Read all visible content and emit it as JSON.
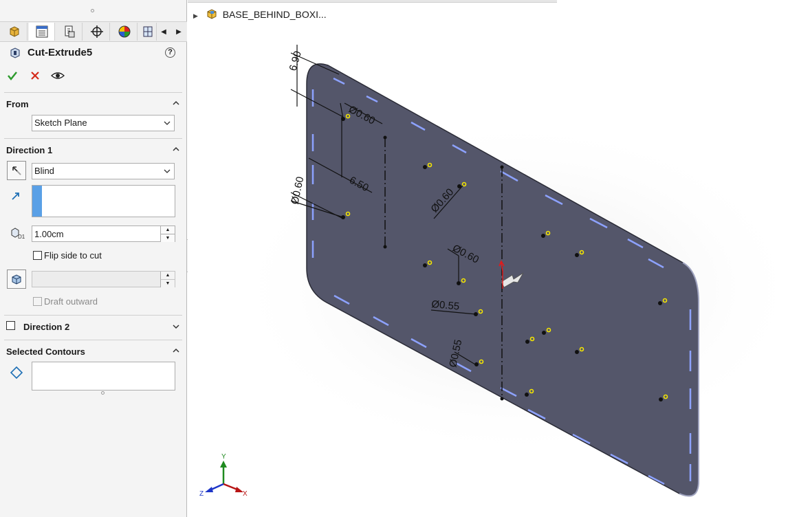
{
  "feature": {
    "title": "Cut-Extrude5",
    "help_glyph": "?"
  },
  "tabs": [
    "feature-manager-icon",
    "property-manager-icon",
    "configuration-manager-icon",
    "dimxpert-icon",
    "display-manager-icon",
    "cam-icon"
  ],
  "from": {
    "label": "From",
    "value": "Sketch Plane"
  },
  "direction1": {
    "label": "Direction 1",
    "end_condition": "Blind",
    "depth": "1.00cm",
    "flip_side_label": "Flip side to cut",
    "draft_outward_label": "Draft outward"
  },
  "direction2": {
    "label": "Direction 2"
  },
  "selected_contours": {
    "label": "Selected Contours"
  },
  "tree": {
    "part_name": "BASE_BEHIND_BOXI..."
  },
  "dimensions": {
    "d1": "6.90",
    "d2": "Ø0.60",
    "d3": "6.50",
    "d4": "Ø0.60",
    "d5": "Ø0.60",
    "d6": "Ø0.60",
    "d7": "Ø0.55",
    "d8": "Ø0.55"
  },
  "triad": {
    "x": "X",
    "y": "Y",
    "z": "Z"
  },
  "colors": {
    "plate": "#54566a",
    "accept": "#2e9b2e",
    "cancel": "#d42a1a",
    "hole_marker": "#f5e600",
    "slot": "#8da2ff"
  }
}
